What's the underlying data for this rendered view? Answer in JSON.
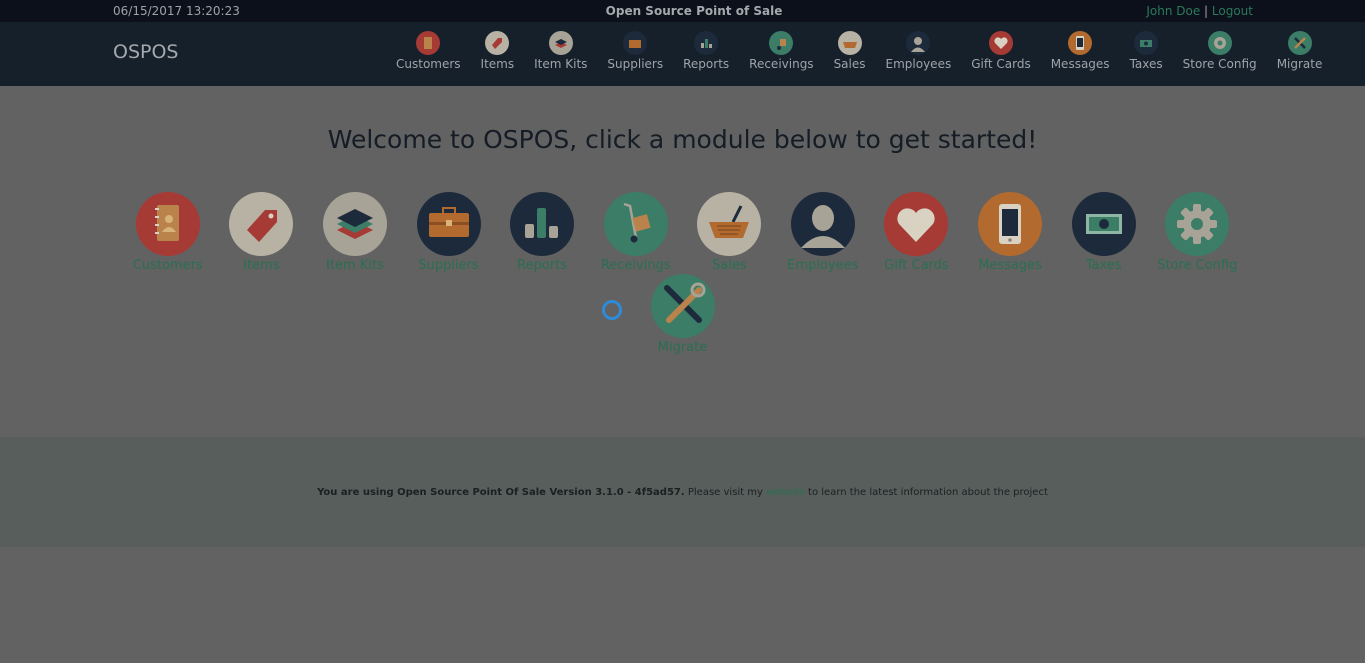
{
  "topbar": {
    "datetime": "06/15/2017 13:20:23",
    "title": "Open Source Point of Sale",
    "user": "John Doe",
    "separator": " | ",
    "logout": "Logout"
  },
  "navbar": {
    "brand": "OSPOS",
    "items": [
      {
        "label": "Customers",
        "icon": "customers-icon",
        "color": "#a63a35"
      },
      {
        "label": "Items",
        "icon": "items-icon",
        "color": "#b7b2a3"
      },
      {
        "label": "Item Kits",
        "icon": "item-kits-icon",
        "color": "#a8a397"
      },
      {
        "label": "Suppliers",
        "icon": "suppliers-icon",
        "color": "#1d2a3c"
      },
      {
        "label": "Reports",
        "icon": "reports-icon",
        "color": "#1d2a3c"
      },
      {
        "label": "Receivings",
        "icon": "receivings-icon",
        "color": "#3b7d67"
      },
      {
        "label": "Sales",
        "icon": "sales-icon",
        "color": "#b7b2a3"
      },
      {
        "label": "Employees",
        "icon": "employees-icon",
        "color": "#1d2a3c"
      },
      {
        "label": "Gift Cards",
        "icon": "gift-cards-icon",
        "color": "#a63a35"
      },
      {
        "label": "Messages",
        "icon": "messages-icon",
        "color": "#b36a2f"
      },
      {
        "label": "Taxes",
        "icon": "taxes-icon",
        "color": "#1d2a3c"
      },
      {
        "label": "Store Config",
        "icon": "store-config-icon",
        "color": "#3b7d67"
      },
      {
        "label": "Migrate",
        "icon": "migrate-icon",
        "color": "#3b7d67"
      }
    ]
  },
  "main": {
    "welcome": "Welcome to OSPOS, click a module below to get started!",
    "modules": [
      {
        "label": "Customers",
        "icon": "customers-icon"
      },
      {
        "label": "Items",
        "icon": "items-icon"
      },
      {
        "label": "Item Kits",
        "icon": "item-kits-icon"
      },
      {
        "label": "Suppliers",
        "icon": "suppliers-icon"
      },
      {
        "label": "Reports",
        "icon": "reports-icon"
      },
      {
        "label": "Receivings",
        "icon": "receivings-icon"
      },
      {
        "label": "Sales",
        "icon": "sales-icon"
      },
      {
        "label": "Employees",
        "icon": "employees-icon"
      },
      {
        "label": "Gift Cards",
        "icon": "gift-cards-icon"
      },
      {
        "label": "Messages",
        "icon": "messages-icon"
      },
      {
        "label": "Taxes",
        "icon": "taxes-icon"
      },
      {
        "label": "Store Config",
        "icon": "store-config-icon"
      },
      {
        "label": "Migrate",
        "icon": "migrate-icon"
      }
    ]
  },
  "footer": {
    "version_text": "You are using Open Source Point Of Sale Version 3.1.0 - 4f5ad57.",
    "visit_text": " Please visit my ",
    "link_text": "website",
    "after_text": " to learn the latest information about the project"
  },
  "colors": {
    "accent": "#2a6f52",
    "overlay_bg": "#616261",
    "navbar_bg": "#16202b",
    "spinner": "#2f8bd8"
  }
}
